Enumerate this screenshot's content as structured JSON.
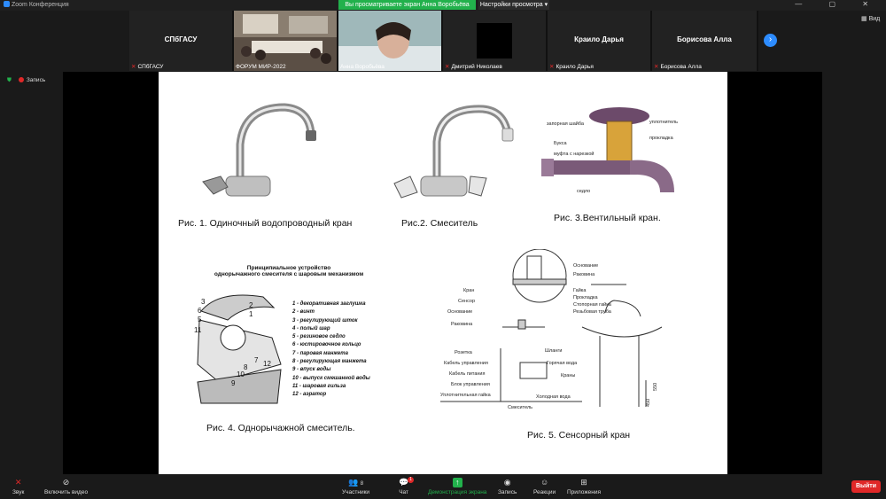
{
  "window": {
    "title": "Zoom Конференция",
    "controls": "— ▢ ✕"
  },
  "share_banner": {
    "text": "Вы просматриваете экран Анна Воробьёва",
    "view_options": "Настройки просмотра ▾"
  },
  "gallery": {
    "tiles": [
      {
        "big_name": "СПбГАСУ",
        "caption": "СПбГАСУ",
        "muted": true
      },
      {
        "big_name": "",
        "caption": "ФОРУМ МИР-2022",
        "muted": false
      },
      {
        "big_name": "",
        "caption": "Анна Воробьёва",
        "muted": false
      },
      {
        "big_name": "",
        "caption": "Дмитрий Николаев",
        "muted": true
      },
      {
        "big_name": "Краило Дарья",
        "caption": "Краило Дарья",
        "muted": true
      },
      {
        "big_name": "Борисова Алла",
        "caption": "Борисова Алла",
        "muted": true
      }
    ],
    "next_icon": "›",
    "view_label": "Вид"
  },
  "recording": {
    "label": "Запись"
  },
  "slide": {
    "captions": {
      "fig1": "Рис. 1. Одиночный водопроводный кран",
      "fig2": "Рис.2. Смеситель",
      "fig3": "Рис. 3.Вентильный кран.",
      "fig4": "Рис. 4. Однорычажной смеситель.",
      "fig5": "Рис. 5. Сенсорный кран"
    },
    "fig4_title_1": "Принципиальное устройство",
    "fig4_title_2": "однорычажного смесителя с шаровым механизмом",
    "fig4_legend": [
      "1 - декоративная заглушка",
      "2 - винт",
      "3 - регулирующий шток",
      "4 - полый шар",
      "5 - резиновое седло",
      "6 - юстировочное кольцо",
      "7 - паровая манжета",
      "8 - регулирующая манжета",
      "9 - впуск воды",
      "10 - выпуск смешанной воды",
      "11 - шаровая гильза",
      "12 - аэратор"
    ],
    "fig5_labels": {
      "kran": "Кран",
      "sensor": "Сенсор",
      "osnovanie_l": "Основание",
      "rakovina_l": "Раковина",
      "rozetka": "Розетка",
      "kabel_upr": "Кабель управления",
      "kabel_pit": "Кабель питания",
      "blok_upr": "Блок управления",
      "uplot_l": "Уплотнительная гайка",
      "smesitel": "Смеситель",
      "osnovanie_r": "Основание",
      "rakovina_r": "Раковина",
      "gaika": "Гайка",
      "prokladka": "Прокладка",
      "stopor": "Стопорная гайка",
      "rezb": "Резьбовая труба",
      "shlangi": "Шланги",
      "goryach": "Горячая вода",
      "krany": "Краны",
      "holod": "Холодная вода",
      "dim550": "550",
      "dim450": "450"
    }
  },
  "toolbar": {
    "audio": "Звук",
    "video": "Включить видео",
    "participants": "Участники",
    "participants_count": "8",
    "chat": "Чат",
    "chat_badge": "1",
    "share": "Демонстрация экрана",
    "record": "Запись",
    "reactions": "Реакции",
    "apps": "Приложения",
    "leave": "Выйти"
  }
}
